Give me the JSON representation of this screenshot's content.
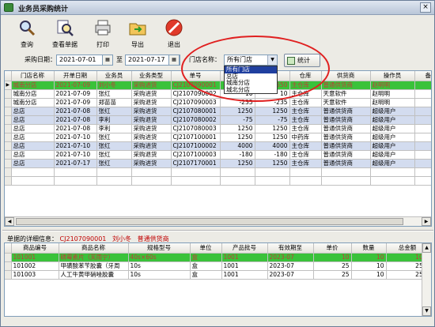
{
  "window": {
    "title": "业务员采购统计",
    "close_label": "×"
  },
  "toolbar": [
    {
      "label": "查询",
      "icon": "magnifier-icon"
    },
    {
      "label": "查看单据",
      "icon": "zoom-document-icon"
    },
    {
      "label": "打印",
      "icon": "printer-icon"
    },
    {
      "label": "导出",
      "icon": "export-folder-icon"
    },
    {
      "label": "退出",
      "icon": "stop-sign-icon"
    }
  ],
  "filter": {
    "date_label": "采购日期：",
    "date_from": "2021-07-01",
    "to_label": "至",
    "date_to": "2021-07-17",
    "store_label": "门店名称：",
    "store_value": "所有门店",
    "store_options": [
      "所有门店",
      "总店",
      "城南分店",
      "城北分店"
    ],
    "stat_button": "统计"
  },
  "main_grid": {
    "columns": [
      "门店名称",
      "开单日期",
      "业务员",
      "业务类型",
      "单号",
      "应付",
      "实付",
      "仓库",
      "供货商",
      "操作员",
      "备注"
    ],
    "rows": [
      [
        "城南分店",
        "2021-07-09",
        "刘小冬",
        "采购进货",
        "CJ2107090001",
        "550",
        "550",
        "主仓库",
        "普通供货商",
        "赵明明",
        ""
      ],
      [
        "城南分店",
        "2021-07-09",
        "张红",
        "采购进货",
        "CJ2107090002",
        "10",
        "10",
        "主仓库",
        "天意软件",
        "赵明明",
        ""
      ],
      [
        "城南分店",
        "2021-07-09",
        "郑苗苗",
        "采购退货",
        "CJ2107090003",
        "-235",
        "-235",
        "主仓库",
        "天意软件",
        "赵明明",
        ""
      ],
      [
        "总店",
        "2021-07-08",
        "张红",
        "采购进货",
        "CJ2107080001",
        "1250",
        "1250",
        "主仓库",
        "普通供货商",
        "超级用户",
        ""
      ],
      [
        "总店",
        "2021-07-08",
        "李利",
        "采购退货",
        "CJ2107080002",
        "-75",
        "-75",
        "主仓库",
        "普通供货商",
        "超级用户",
        ""
      ],
      [
        "总店",
        "2021-07-08",
        "李利",
        "采购进货",
        "CJ2107080003",
        "1250",
        "1250",
        "主仓库",
        "普通供货商",
        "超级用户",
        ""
      ],
      [
        "总店",
        "2021-07-10",
        "张红",
        "采购进货",
        "CJ2107100001",
        "1250",
        "1250",
        "中药库",
        "普通供货商",
        "超级用户",
        ""
      ],
      [
        "总店",
        "2021-07-10",
        "张红",
        "采购进货",
        "CJ2107100002",
        "4000",
        "4000",
        "主仓库",
        "普通供货商",
        "超级用户",
        ""
      ],
      [
        "总店",
        "2021-07-10",
        "张红",
        "采购退货",
        "CJ2107100003",
        "-180",
        "-180",
        "主仓库",
        "普通供货商",
        "超级用户",
        ""
      ],
      [
        "总店",
        "2021-07-17",
        "张红",
        "采购进货",
        "CJ2107170001",
        "1250",
        "1250",
        "主仓库",
        "普通供货商",
        "超级用户",
        ""
      ]
    ]
  },
  "detail": {
    "label": "单据的详细信息：",
    "order_no": "CJ2107090001",
    "salesman": "刘小冬",
    "supplier": "普通供货商",
    "columns": [
      "商品编号",
      "商品名称",
      "规格型号",
      "单位",
      "产品批号",
      "有效期至",
      "单价",
      "数量",
      "总金额"
    ],
    "rows": [
      [
        "101001",
        "磷霉素片（芙雨宁）",
        "40s×60s",
        "盒",
        "1001",
        "2023-07",
        "10",
        "10",
        "100"
      ],
      [
        "101002",
        "甲磺酸苯苄胶囊（牙周",
        "10s",
        "盒",
        "1001",
        "2023-07",
        "25",
        "10",
        "250"
      ],
      [
        "101003",
        "人工牛黄甲硝唑胶囊",
        "10s",
        "盒",
        "1001",
        "2023-07",
        "25",
        "10",
        "250"
      ]
    ]
  },
  "colors": {
    "highlight_row": "#3ac23a",
    "highlight_text": "#c43a3a",
    "alt_row": "#d3dcef",
    "annotation": "#e02020"
  }
}
